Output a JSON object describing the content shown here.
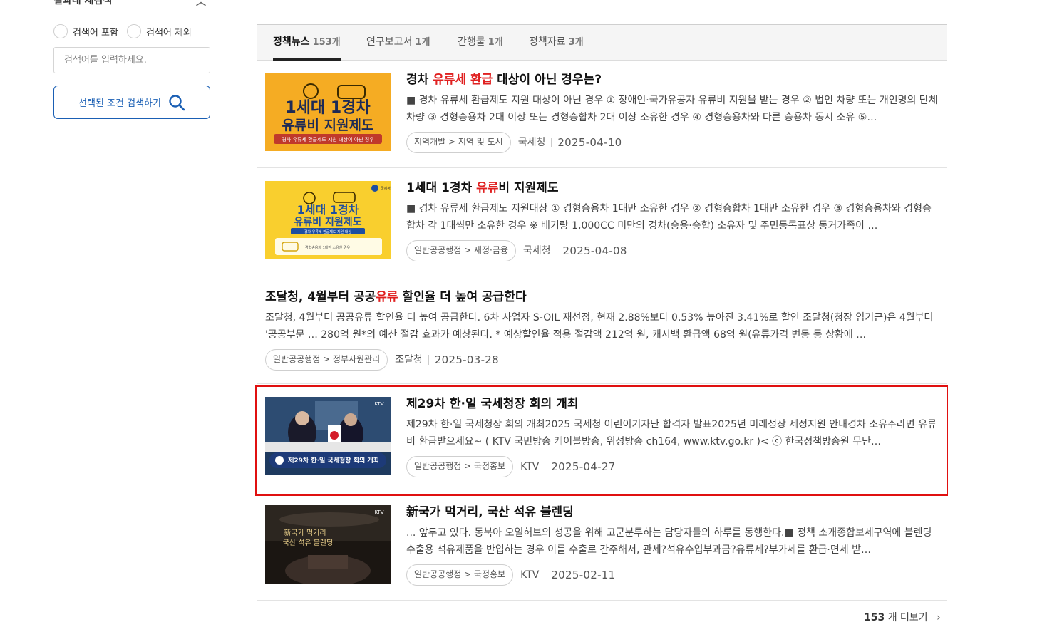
{
  "sidebar": {
    "title": "결과내 재검색",
    "radio_include": "검색어 포함",
    "radio_exclude": "검색어 제외",
    "search_placeholder": "검색어를 입력하세요.",
    "search_button": "선택된 조건 검색하기"
  },
  "tabs": [
    {
      "label": "정책뉴스",
      "count": "153개",
      "active": true
    },
    {
      "label": "연구보고서",
      "count": "1개",
      "active": false
    },
    {
      "label": "간행물",
      "count": "1개",
      "active": false
    },
    {
      "label": "정책자료",
      "count": "3개",
      "active": false
    }
  ],
  "results": [
    {
      "title_parts": [
        {
          "t": "경차 "
        },
        {
          "t": "유류세",
          "hl": true
        },
        {
          "t": " "
        },
        {
          "t": "환급",
          "hl": true
        },
        {
          "t": " 대상이 아닌 경우는?"
        }
      ],
      "desc": "■ 경차 유류세 환급제도 지원 대상이 아닌 경우 ① 장애인·국가유공자 유류비 지원을 받는 경우 ② 법인 차량 또는 개인명의 단체차량 ③ 경형승용차 2대 이상 또는 경형승합차 2대 이상 소유한 경우 ④ 경형승용차와 다른 승용차 동시 소유 ⑤…",
      "category": "지역개발 > 지역 및 도시",
      "source": "국세청",
      "date": "2025-04-10",
      "thumb_text": [
        "1세대 1경차",
        "유류비 지원제도",
        "경차 유류세 환급제도 지원 대상이 아닌 경우"
      ]
    },
    {
      "title_parts": [
        {
          "t": "1세대 1경차 "
        },
        {
          "t": "유류",
          "hl": true
        },
        {
          "t": "비 지원제도"
        }
      ],
      "desc": "■ 경차 유류세 환급제도 지원대상 ① 경형승용차 1대만 소유한 경우 ② 경형승합차 1대만 소유한 경우 ③ 경형승용차와 경형승합차 각 1대씩만 소유한 경우 ※ 배기량 1,000CC 미만의 경차(승용·승합) 소유자 및 주민등록표상 동거가족이 …",
      "category": "일반공공행정 > 재정·금융",
      "source": "국세청",
      "date": "2025-04-08",
      "thumb_text": [
        "1세대 1경차",
        "유류비 지원제도",
        "경차 유류세 환급제도 지원 대상",
        "경형승용차 1대만 소유한 경우",
        "국세청"
      ]
    },
    {
      "title_parts": [
        {
          "t": "조달청, 4월부터 공공"
        },
        {
          "t": "유류",
          "hl": true
        },
        {
          "t": " 할인율 더 높여 공급한다"
        }
      ],
      "desc": "조달청, 4월부터 공공유류 할인율 더 높여 공급한다. 6차 사업자 S-OIL 재선정, 현재 2.88%보다 0.53% 높아진 3.41%로 할인 조달청(청장 임기근)은 4월부터 '공공부문 … 280억 원*의 예산 절감 효과가 예상된다. * 예상할인율 적용 절감액 212억 원, 캐시백 환급액 68억 원(유류가격 변동 등 상황에 …",
      "category": "일반공공행정 > 정부자원관리",
      "source": "조달청",
      "date": "2025-03-28"
    },
    {
      "title_parts": [
        {
          "t": "제29차 한·일 국세청장 회의 개최"
        }
      ],
      "desc": "제29차 한·일 국세청장 회의 개최2025 국세청 어린이기자단 합격자 발표2025년 미래성장 세정지원 안내경차 소유주라면 유류비 환급받으세요~ ( KTV 국민방송 케이블방송, 위성방송 ch164, www.ktv.go.kr )< ⓒ 한국정책방송원 무단…",
      "category": "일반공공행정 > 국정홍보",
      "source": "KTV",
      "date": "2025-04-27",
      "thumb_text": [
        "KTV",
        "제29차 한·일 국세청장 회의 개최"
      ]
    },
    {
      "title_parts": [
        {
          "t": "新국가 먹거리, 국산 석유 블렌딩"
        }
      ],
      "desc": "... 앞두고 있다. 동북아 오일허브의 성공을 위해 고군분투하는 담당자들의 하루를 동행한다.■ 정책 소개종합보세구역에 블렌딩 수출용 석유제품을 반입하는 경우 이를 수출로 간주해서, 관세?석유수입부과금?유류세?부가세를 환급·면세 받…",
      "category": "일반공공행정 > 국정홍보",
      "source": "KTV",
      "date": "2025-02-11",
      "thumb_text": [
        "KTV",
        "新국가 먹거리",
        "국산 석유 블렌딩"
      ]
    }
  ],
  "more": {
    "count": "153",
    "label": "개 더보기"
  }
}
